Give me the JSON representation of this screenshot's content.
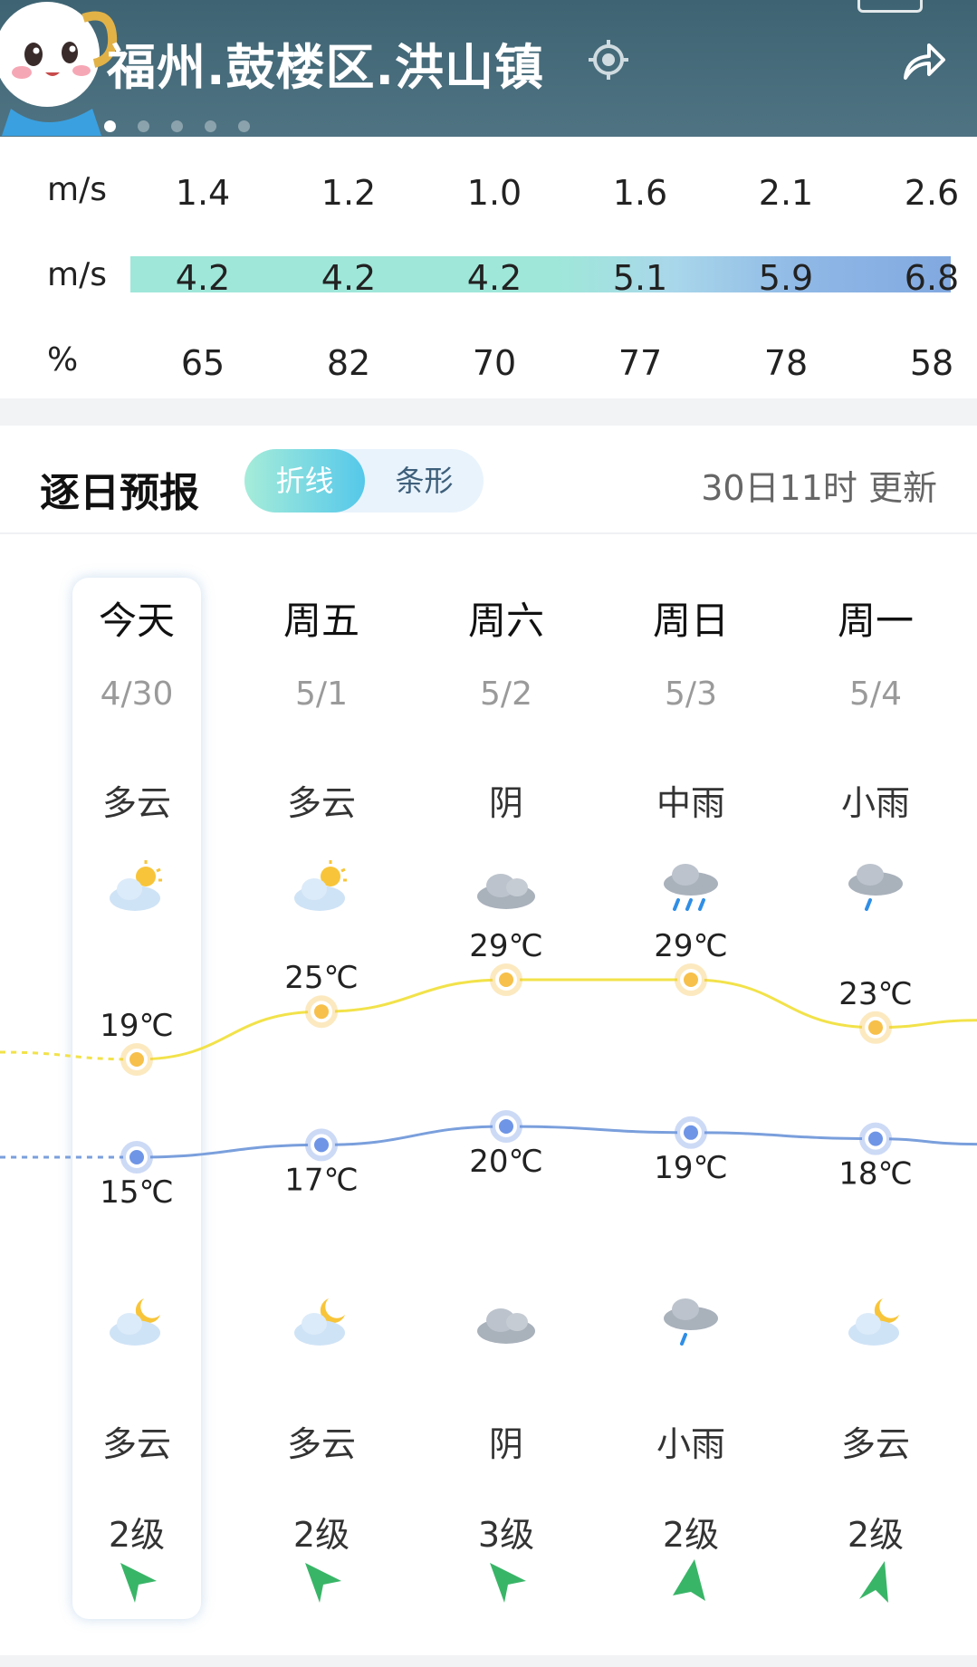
{
  "header": {
    "location": "福州.鼓楼区.洪山镇",
    "page_indicator": {
      "count": 5,
      "active": 0
    }
  },
  "hourly": {
    "rows": [
      {
        "unit": "m/s",
        "values": [
          "1.4",
          "1.2",
          "1.0",
          "1.6",
          "2.1",
          "2.6"
        ]
      },
      {
        "unit": "m/s",
        "values": [
          "4.2",
          "4.2",
          "4.2",
          "5.1",
          "5.9",
          "6.8"
        ]
      },
      {
        "unit": "%",
        "values": [
          "65",
          "82",
          "70",
          "77",
          "78",
          "58"
        ]
      }
    ]
  },
  "daily": {
    "title": "逐日预报",
    "toggle": {
      "line": "折线",
      "bar": "条形",
      "selected": "折线"
    },
    "update_time": "30日11时 更新",
    "days": [
      {
        "day": "今天",
        "date": "4/30",
        "weather_day": "多云",
        "icon_day": "partly-cloudy-day-icon",
        "high": 19,
        "high_label": "19℃",
        "low": 15,
        "low_label": "15℃",
        "icon_night": "partly-cloudy-night-icon",
        "weather_night": "多云",
        "wind_level": "2级",
        "wind_dir_deg": 315
      },
      {
        "day": "周五",
        "date": "5/1",
        "weather_day": "多云",
        "icon_day": "partly-cloudy-day-icon",
        "high": 25,
        "high_label": "25℃",
        "low": 17,
        "low_label": "17℃",
        "icon_night": "partly-cloudy-night-icon",
        "weather_night": "多云",
        "wind_level": "2级",
        "wind_dir_deg": 315
      },
      {
        "day": "周六",
        "date": "5/2",
        "weather_day": "阴",
        "icon_day": "overcast-icon",
        "high": 29,
        "high_label": "29℃",
        "low": 20,
        "low_label": "20℃",
        "icon_night": "overcast-icon",
        "weather_night": "阴",
        "wind_level": "3级",
        "wind_dir_deg": 315
      },
      {
        "day": "周日",
        "date": "5/3",
        "weather_day": "中雨",
        "icon_day": "moderate-rain-icon",
        "high": 29,
        "high_label": "29℃",
        "low": 19,
        "low_label": "19℃",
        "icon_night": "light-rain-icon",
        "weather_night": "小雨",
        "wind_level": "2级",
        "wind_dir_deg": 0
      },
      {
        "day": "周一",
        "date": "5/4",
        "weather_day": "小雨",
        "icon_day": "light-rain-icon",
        "high": 23,
        "high_label": "23℃",
        "low": 18,
        "low_label": "18℃",
        "icon_night": "partly-cloudy-night-icon",
        "weather_night": "多云",
        "wind_level": "2级",
        "wind_dir_deg": 20
      }
    ],
    "colors": {
      "high_line": "#f2e24a",
      "low_line": "#7a9fdc",
      "high_dot": "#f7c04a",
      "low_dot": "#6f95e6",
      "wind_arrow": "#39b567"
    }
  }
}
